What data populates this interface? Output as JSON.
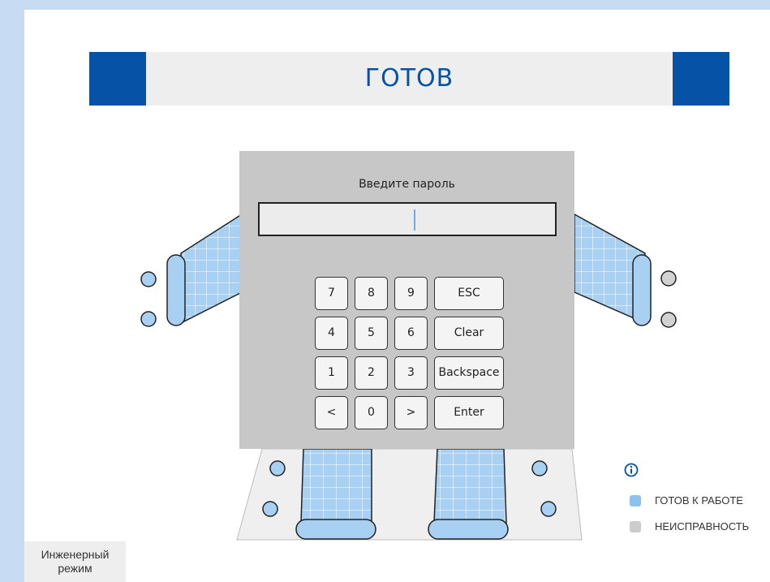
{
  "status": {
    "title": "ГОТОВ",
    "color": "#0552a6"
  },
  "dialog": {
    "label": "Введите пароль",
    "input_value": "",
    "keys": {
      "k7": "7",
      "k8": "8",
      "k9": "9",
      "esc": "ESC",
      "k4": "4",
      "k5": "5",
      "k6": "6",
      "clear": "Clear",
      "k1": "1",
      "k2": "2",
      "k3": "3",
      "backspace": "Backspace",
      "left": "<",
      "k0": "0",
      "right": ">",
      "enter": "Enter"
    }
  },
  "legend": {
    "icon": "info-icon",
    "ready": {
      "label": "ГОТОВ К РАБОТЕ",
      "color": "#8cc2ee"
    },
    "fault": {
      "label": "НЕИСПРАВНОСТЬ",
      "color": "#cccccc"
    }
  },
  "engineer_button": {
    "line1": "Инженерный",
    "line2": "режим"
  },
  "colors": {
    "background": "#c7dcf2",
    "panel_blue": "#a7d0f2",
    "dialog_bg": "#c8c7c7"
  }
}
